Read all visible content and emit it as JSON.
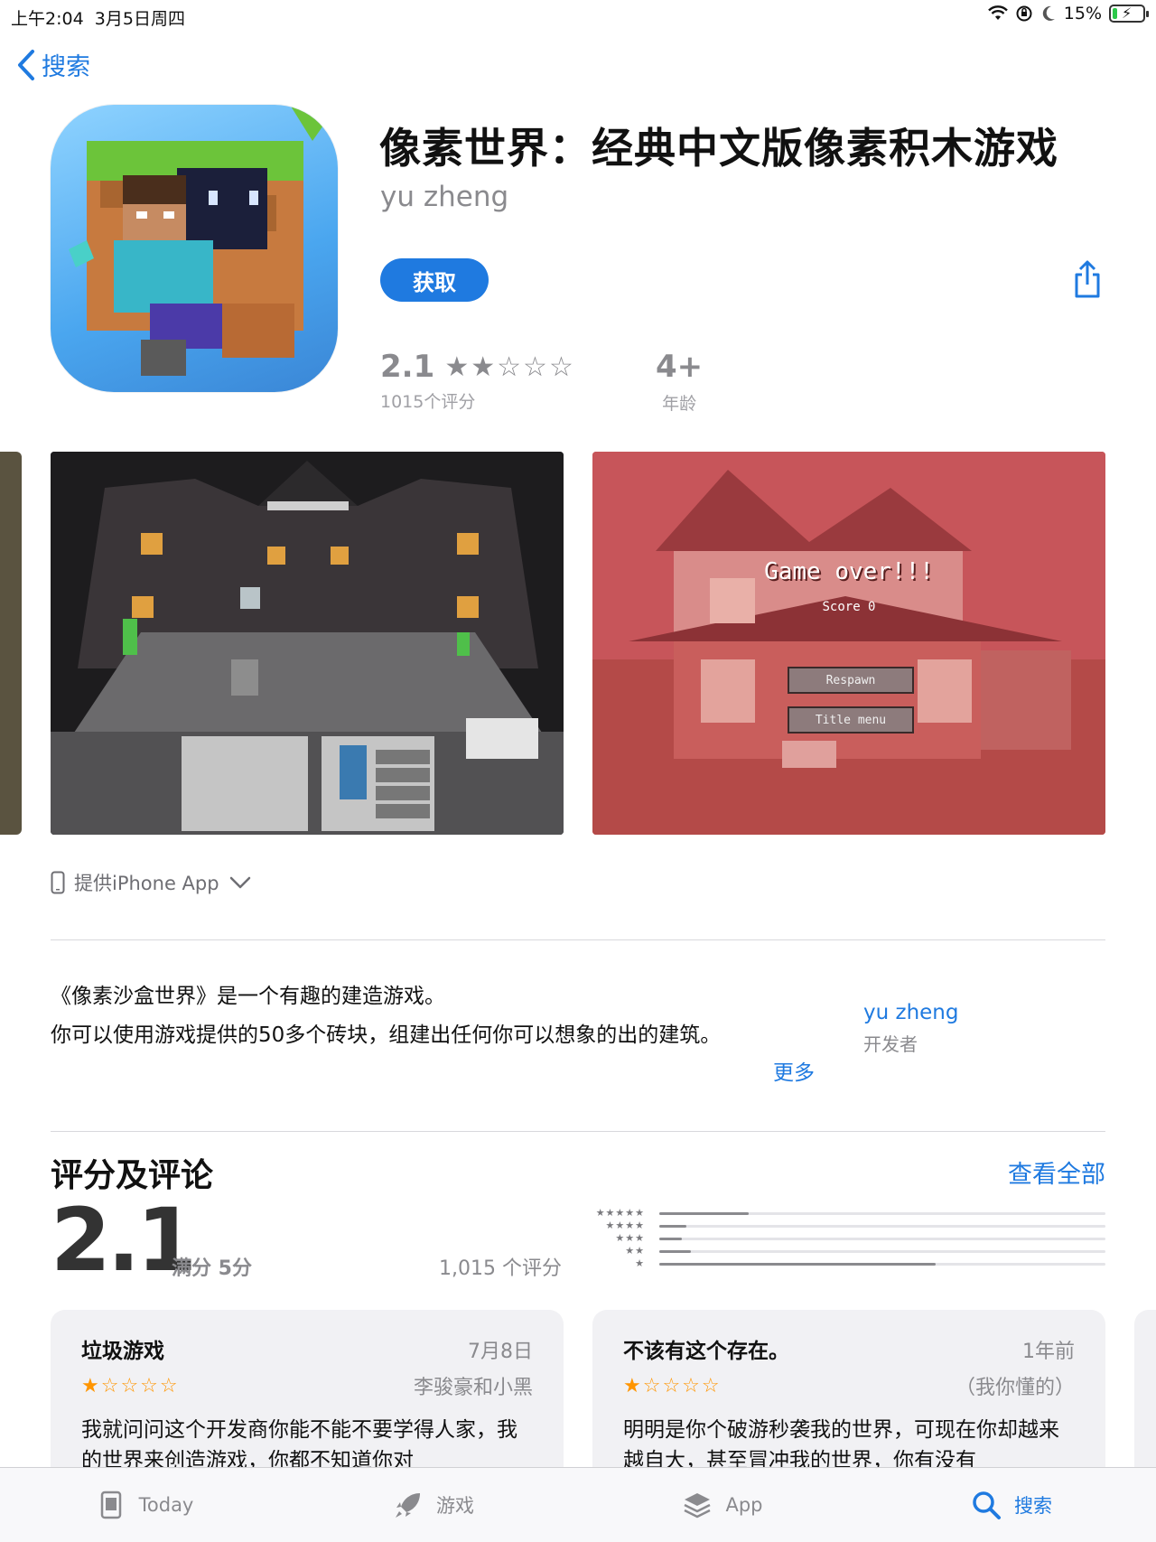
{
  "status_bar": {
    "time": "上午2:04",
    "date": "3月5日周四",
    "battery": "15%",
    "battery_level": 0.15
  },
  "nav": {
    "back_label": "搜索"
  },
  "app": {
    "title": "像素世界：经典中文版像素积木游戏",
    "developer": "yu zheng",
    "get_label": "获取",
    "rating_value": "2.1",
    "rating_stars": 2,
    "rating_count": "1015个评分",
    "age_value": "4+",
    "age_label": "年龄"
  },
  "screenshots": {
    "shot2_title": "Game over!!!",
    "shot2_score": "Score 0",
    "shot2_button1": "Respawn",
    "shot2_button2": "Title menu"
  },
  "device_support": "提供iPhone App",
  "description": {
    "line1": "《像素沙盒世界》是一个有趣的建造游戏。",
    "line2": "你可以使用游戏提供的50多个砖块，组建出任何你可以想象的出的建筑。",
    "more_label": "更多",
    "developer_name": "yu zheng",
    "developer_label": "开发者"
  },
  "ratings": {
    "section_title": "评分及评论",
    "see_all": "查看全部",
    "average": "2.1",
    "out_of": "满分 5分",
    "total": "1,015 个评分",
    "histogram": [
      {
        "stars": "★★★★★",
        "fraction": 0.2
      },
      {
        "stars": "★★★★",
        "fraction": 0.06
      },
      {
        "stars": "★★★",
        "fraction": 0.05
      },
      {
        "stars": "★★",
        "fraction": 0.07
      },
      {
        "stars": "★",
        "fraction": 0.62
      }
    ]
  },
  "reviews": [
    {
      "title": "垃圾游戏",
      "date": "7月8日",
      "author": "李骏豪和小黑",
      "stars": "★☆☆☆☆",
      "body": "我就问问这个开发商你能不能不要学得人家，我的世界来创造游戏，你都不知道你对"
    },
    {
      "title": "不该有这个存在。",
      "date": "1年前",
      "author": "（我你懂的）",
      "stars": "★☆☆☆☆",
      "body": "明明是你个破游秒袭我的世界，可现在你却越来越自大，甚至冒冲我的世界，你有没有"
    }
  ],
  "tab_bar": {
    "today": "Today",
    "games": "游戏",
    "apps": "App",
    "search": "搜索"
  },
  "colors": {
    "accent": "#1f7ae0",
    "star_orange": "#ff9500"
  }
}
